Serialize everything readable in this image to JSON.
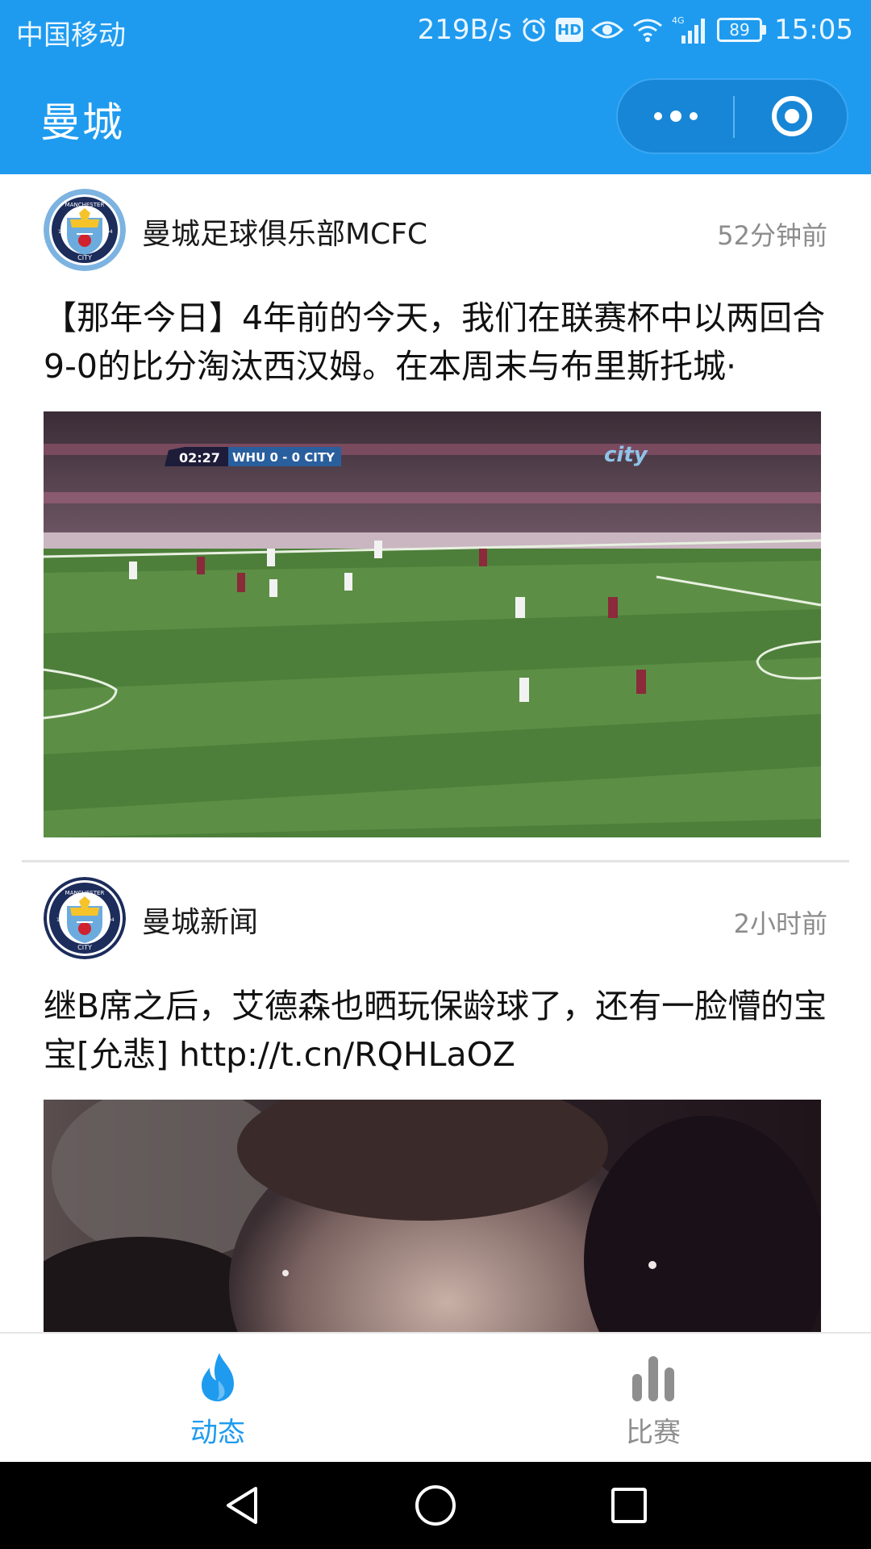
{
  "status_bar": {
    "carrier": "中国移动",
    "net_speed": "219B/s",
    "hd_badge": "HD",
    "signal_type": "4G",
    "battery": "89",
    "time": "15:05",
    "icons": [
      "alarm-icon",
      "hd-icon",
      "eye-icon",
      "wifi-icon",
      "signal-icon",
      "battery-icon"
    ]
  },
  "header": {
    "title": "曼城",
    "menu_icon": "more-dots-icon",
    "close_icon": "target-close-icon",
    "bg_color": "#1e9bef"
  },
  "feed": {
    "posts": [
      {
        "author": "曼城足球俱乐部MCFC",
        "time_ago": "52分钟前",
        "text": "【那年今日】4年前的今天，我们在联赛杯中以两回合9-0的比分淘汰西汉姆。在本周末与布里斯托城·",
        "avatar": "mcfc-badge",
        "media": {
          "type": "video-thumbnail",
          "scoreboard_time": "02:27",
          "scoreboard_text": "WHU 0 - 0 CITY",
          "watermark": "city"
        }
      },
      {
        "author": "曼城新闻",
        "time_ago": "2小时前",
        "text": "继B席之后，艾德森也晒玩保龄球了，还有一脸懵的宝宝[允悲] http://t.cn/RQHLaOZ",
        "avatar": "mcfc-badge",
        "media": {
          "type": "photo"
        }
      }
    ]
  },
  "tabbar": {
    "tabs": [
      {
        "label": "动态",
        "icon": "flame-icon",
        "active": true
      },
      {
        "label": "比赛",
        "icon": "bar-chart-icon",
        "active": false
      }
    ],
    "active_color": "#1e9bef",
    "inactive_color": "#8e8e8e"
  },
  "system_nav": {
    "buttons": [
      "back-icon",
      "home-icon",
      "recents-icon"
    ]
  },
  "badge_text": {
    "top": "MANCHESTER",
    "bottom": "CITY",
    "year_left": "18",
    "year_right": "94"
  }
}
